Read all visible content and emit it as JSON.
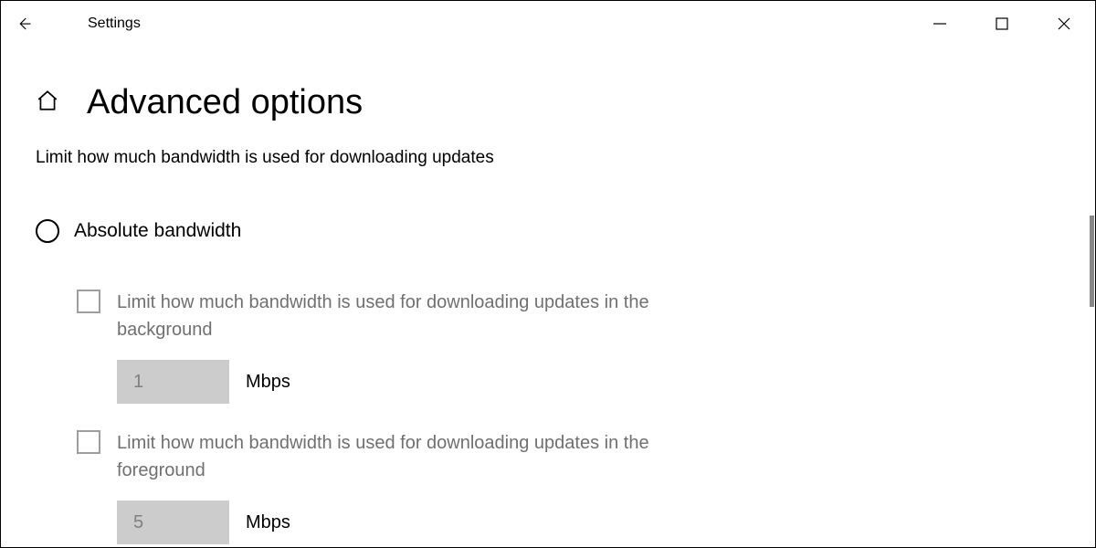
{
  "titlebar": {
    "title": "Settings"
  },
  "page": {
    "title": "Advanced options",
    "description": "Limit how much bandwidth is used for downloading updates"
  },
  "radio": {
    "label": "Absolute bandwidth"
  },
  "options": {
    "background": {
      "label": "Limit how much bandwidth is used for downloading updates in the background",
      "value": "1",
      "unit": "Mbps"
    },
    "foreground": {
      "label": "Limit how much bandwidth is used for downloading updates in the foreground",
      "value": "5",
      "unit": "Mbps"
    }
  }
}
